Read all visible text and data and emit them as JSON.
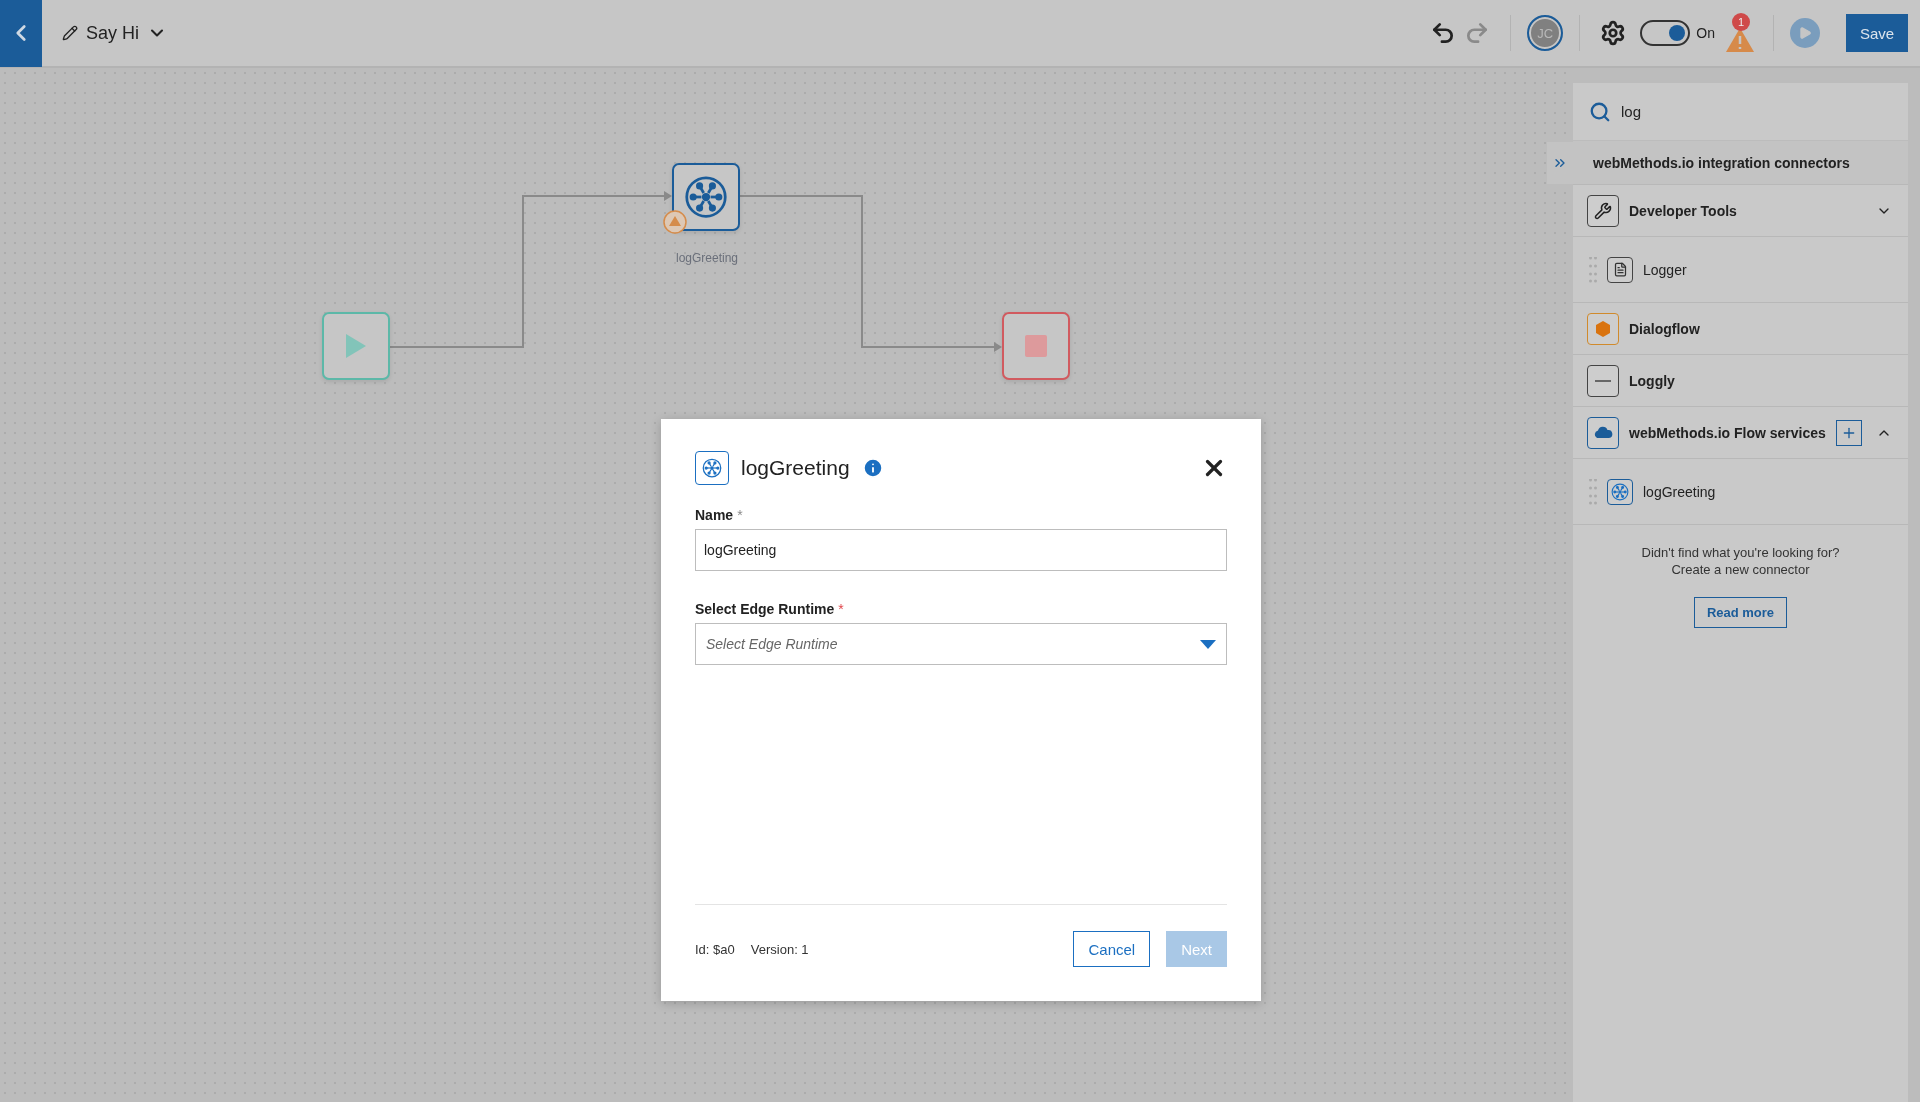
{
  "header": {
    "title": "Say Hi",
    "history": [
      {
        "kind": "undo",
        "disabled": false
      },
      {
        "kind": "redo",
        "disabled": true
      }
    ],
    "avatar": "JC",
    "toggle": {
      "on": true,
      "label": "On"
    },
    "alert_count": "1",
    "run_disabled": true,
    "save": "Save"
  },
  "canvas": {
    "nodes": [
      {
        "kind": "start"
      },
      {
        "kind": "service",
        "label": "logGreeting",
        "warning": true
      },
      {
        "kind": "end"
      }
    ]
  },
  "panel": {
    "search": {
      "value": "log"
    },
    "section": "webMethods.io integration connectors",
    "items": [
      {
        "kind": "group",
        "label": "Developer Tools",
        "expanded": false,
        "addable": false
      },
      {
        "kind": "item",
        "label": "Logger"
      },
      {
        "kind": "group",
        "label": "Dialogflow"
      },
      {
        "kind": "group",
        "label": "Loggly"
      },
      {
        "kind": "group",
        "label": "webMethods.io Flow services",
        "expanded": true,
        "addable": true
      },
      {
        "kind": "item",
        "label": "logGreeting"
      }
    ],
    "footer": [
      "Didn't find what you're looking for?",
      "Create a new connector"
    ],
    "read_more": "Read more"
  },
  "dialog": {
    "title": "logGreeting",
    "fields": [
      {
        "kind": "text",
        "label": "Name",
        "mark": "*",
        "value": "logGreeting"
      },
      {
        "kind": "select",
        "label": "Select Edge Runtime",
        "mark": "*",
        "placeholder": "Select Edge Runtime"
      }
    ],
    "id": "Id: $a0",
    "version": "Version: 1",
    "buttons": [
      {
        "kind": "secondary",
        "label": "Cancel",
        "disabled": false
      },
      {
        "kind": "primary",
        "label": "Next",
        "disabled": true
      }
    ]
  }
}
